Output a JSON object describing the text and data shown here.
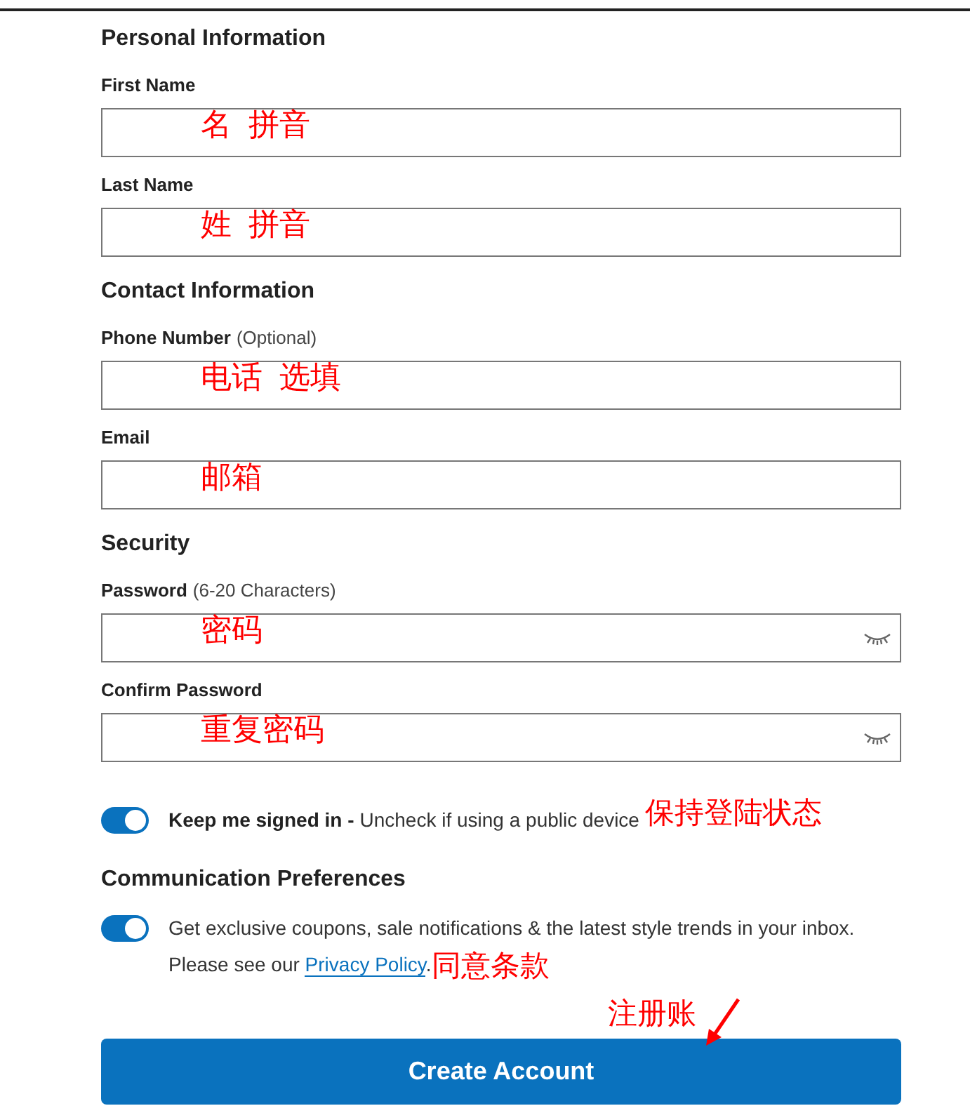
{
  "sections": [
    {
      "title": "Personal Information",
      "fields": [
        {
          "label": "First Name",
          "kind": "text",
          "annotation": "名  拼音"
        },
        {
          "label": "Last Name",
          "kind": "text",
          "annotation": "姓  拼音"
        }
      ]
    },
    {
      "title": "Contact Information",
      "fields": [
        {
          "label": "Phone Number",
          "hint": "(Optional)",
          "kind": "text",
          "annotation": "电话  选填"
        },
        {
          "label": "Email",
          "kind": "text",
          "annotation": "邮箱"
        }
      ]
    },
    {
      "title": "Security",
      "fields": [
        {
          "label": "Password",
          "hint": "(6-20 Characters)",
          "kind": "password",
          "annotation": "密码"
        },
        {
          "label": "Confirm Password",
          "kind": "password",
          "annotation": "重复密码"
        }
      ]
    }
  ],
  "keep_signed_in": {
    "on": true,
    "label": "Keep me signed in -",
    "text": "Uncheck if using a public device",
    "annotation": "保持登陆状态"
  },
  "communication": {
    "title": "Communication Preferences",
    "on": true,
    "text": "Get exclusive coupons, sale notifications & the latest style trends in your inbox.",
    "text2": "Please see our",
    "link": "Privacy Policy",
    "after": ".",
    "annotation": "同意条款"
  },
  "submit": {
    "label": "Create Account",
    "annotation": "注册账"
  }
}
